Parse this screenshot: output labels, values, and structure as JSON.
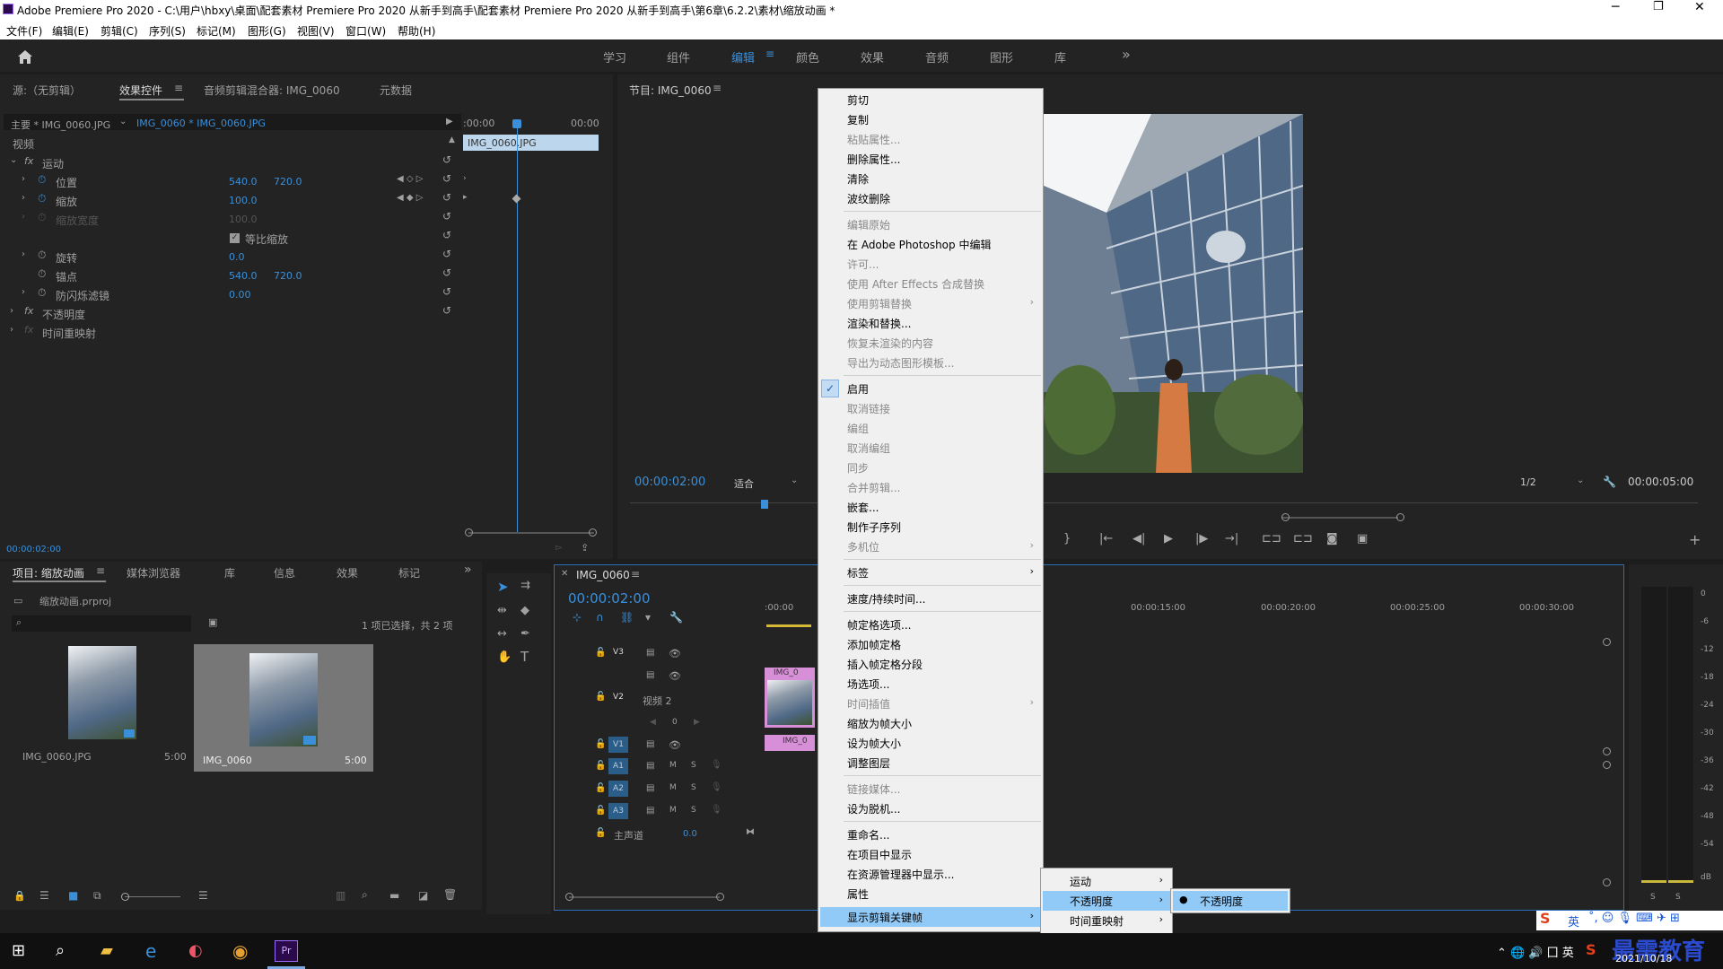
{
  "app": {
    "title": "Adobe Premiere Pro 2020 - C:\\用户\\hbxy\\桌面\\配套素材 Premiere Pro 2020 从新手到高手\\配套素材 Premiere Pro 2020 从新手到高手\\第6章\\6.2.2\\素材\\缩放动画 *"
  },
  "menu": [
    "文件(F)",
    "编辑(E)",
    "剪辑(C)",
    "序列(S)",
    "标记(M)",
    "图形(G)",
    "视图(V)",
    "窗口(W)",
    "帮助(H)"
  ],
  "workspaces": [
    "学习",
    "组件",
    "编辑",
    "颜色",
    "效果",
    "音频",
    "图形",
    "库"
  ],
  "workspace_more": "»",
  "source_tabs": [
    "源:（无剪辑）",
    "效果控件",
    "音频剪辑混合器: IMG_0060",
    "元数据"
  ],
  "effect_controls": {
    "master": "主要 * IMG_0060.JPG",
    "clip": "IMG_0060 * IMG_0060.JPG",
    "tc_start": ":00:00",
    "tc_end": "00:00",
    "clip_bar": "IMG_0060.JPG",
    "video_label": "视频",
    "motion": "运动",
    "position": "位置",
    "pos_x": "540.0",
    "pos_y": "720.0",
    "scale": "缩放",
    "scale_v": "100.0",
    "scale_w": "缩放宽度",
    "scale_w_v": "100.0",
    "uniform": "等比缩放",
    "rotation": "旋转",
    "rot_v": "0.0",
    "anchor": "锚点",
    "anc_x": "540.0",
    "anc_y": "720.0",
    "flicker": "防闪烁滤镜",
    "flicker_v": "0.00",
    "opacity": "不透明度",
    "timeremap": "时间重映射",
    "timecode": "00:00:02:00"
  },
  "program": {
    "title": "节目: IMG_0060",
    "timecode": "00:00:02:00",
    "fit": "适合",
    "res": "1/2",
    "duration": "00:00:05:00"
  },
  "project": {
    "tabs": [
      "项目: 缩放动画",
      "媒体浏览器",
      "库",
      "信息",
      "效果",
      "标记"
    ],
    "file": "缩放动画.prproj",
    "status": "1 项已选择，共 2 项",
    "items": [
      {
        "name": "IMG_0060.JPG",
        "dur": "5:00"
      },
      {
        "name": "IMG_0060",
        "dur": "5:00"
      }
    ]
  },
  "timeline": {
    "tab": "IMG_0060",
    "timecode": "00:00:02:00",
    "ruler": [
      ":00:00",
      "00:00:15:00",
      "00:00:20:00",
      "00:00:25:00",
      "00:00:30:00"
    ],
    "tracks": [
      {
        "name": "V3"
      },
      {
        "name": "V2",
        "label": "视频 2"
      },
      {
        "name": "V1"
      },
      {
        "name": "A1",
        "m": "M",
        "s": "S"
      },
      {
        "name": "A2",
        "m": "M",
        "s": "S"
      },
      {
        "name": "A3",
        "m": "M",
        "s": "S"
      }
    ],
    "master": "主声道",
    "master_v": "0.0",
    "clip_label": "IMG_0",
    "kf_value": "0"
  },
  "meter": {
    "ticks": [
      "0",
      "-6",
      "-12",
      "-18",
      "-24",
      "-30",
      "-36",
      "-42",
      "-48",
      "-54",
      "dB"
    ],
    "s": "S"
  },
  "context_menu": {
    "items": [
      {
        "label": "剪切",
        "enabled": true
      },
      {
        "label": "复制",
        "enabled": true
      },
      {
        "label": "粘贴属性...",
        "enabled": false
      },
      {
        "label": "删除属性...",
        "enabled": true
      },
      {
        "label": "清除",
        "enabled": true
      },
      {
        "label": "波纹删除",
        "enabled": true
      },
      {
        "label": "编辑原始",
        "enabled": false
      },
      {
        "label": "在 Adobe Photoshop 中编辑",
        "enabled": true
      },
      {
        "label": "许可...",
        "enabled": false
      },
      {
        "label": "使用 After Effects 合成替换",
        "enabled": false
      },
      {
        "label": "使用剪辑替换",
        "enabled": false
      },
      {
        "label": "渲染和替换...",
        "enabled": true
      },
      {
        "label": "恢复未渲染的内容",
        "enabled": false
      },
      {
        "label": "导出为动态图形模板...",
        "enabled": false
      },
      {
        "label": "启用",
        "enabled": true
      },
      {
        "label": "取消链接",
        "enabled": false
      },
      {
        "label": "编组",
        "enabled": false
      },
      {
        "label": "取消编组",
        "enabled": false
      },
      {
        "label": "同步",
        "enabled": false
      },
      {
        "label": "合并剪辑...",
        "enabled": false
      },
      {
        "label": "嵌套...",
        "enabled": true
      },
      {
        "label": "制作子序列",
        "enabled": true
      },
      {
        "label": "多机位",
        "enabled": false
      },
      {
        "label": "标签",
        "enabled": true
      },
      {
        "label": "速度/持续时间...",
        "enabled": true
      },
      {
        "label": "帧定格选项...",
        "enabled": true
      },
      {
        "label": "添加帧定格",
        "enabled": true
      },
      {
        "label": "插入帧定格分段",
        "enabled": true
      },
      {
        "label": "场选项...",
        "enabled": true
      },
      {
        "label": "时间插值",
        "enabled": false
      },
      {
        "label": "缩放为帧大小",
        "enabled": true
      },
      {
        "label": "设为帧大小",
        "enabled": true
      },
      {
        "label": "调整图层",
        "enabled": true
      },
      {
        "label": "链接媒体...",
        "enabled": false
      },
      {
        "label": "设为脱机...",
        "enabled": true
      },
      {
        "label": "重命名...",
        "enabled": true
      },
      {
        "label": "在项目中显示",
        "enabled": true
      },
      {
        "label": "在资源管理器中显示...",
        "enabled": true
      },
      {
        "label": "属性",
        "enabled": true
      },
      {
        "label": "显示剪辑关键帧",
        "enabled": true
      }
    ],
    "submenu": [
      "运动",
      "不透明度",
      "时间重映射"
    ],
    "submenu2": [
      "不透明度"
    ]
  },
  "taskbar": {
    "ime": "英",
    "date": "2021/10/18",
    "watermark": "最需教育"
  }
}
